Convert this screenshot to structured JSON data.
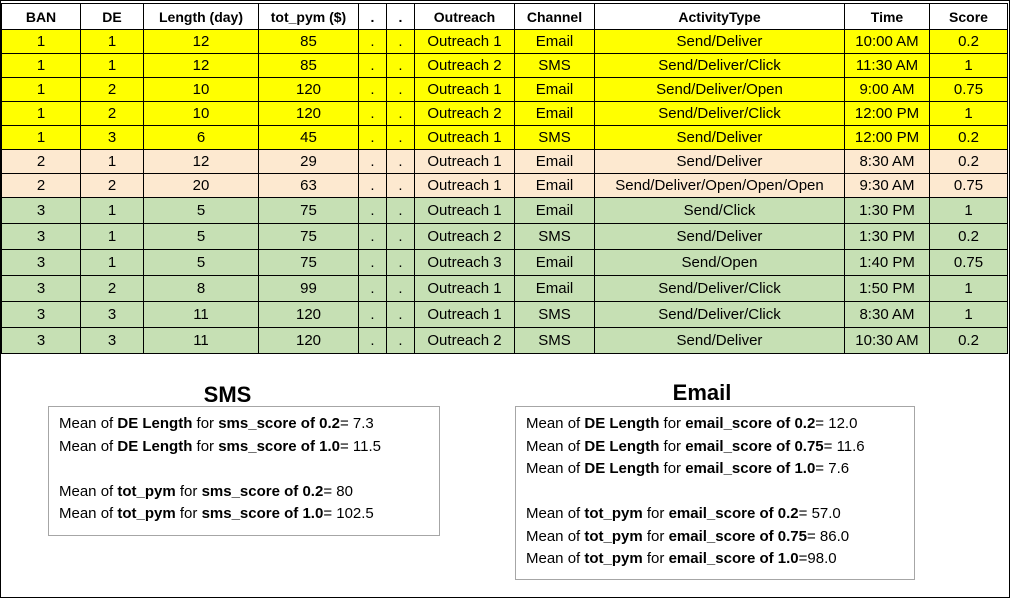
{
  "table": {
    "headers": [
      "BAN",
      "DE",
      "Length (day)",
      "tot_pym ($)",
      ".",
      ".",
      "Outreach",
      "Channel",
      "ActivityType",
      "Time",
      "Score"
    ],
    "rows": [
      {
        "group": "y",
        "cells": [
          "1",
          "1",
          "12",
          "85",
          ".",
          ".",
          "Outreach 1",
          "Email",
          "Send/Deliver",
          "10:00 AM",
          "0.2"
        ]
      },
      {
        "group": "y",
        "cells": [
          "1",
          "1",
          "12",
          "85",
          ".",
          ".",
          "Outreach 2",
          "SMS",
          "Send/Deliver/Click",
          "11:30 AM",
          "1"
        ]
      },
      {
        "group": "y",
        "cells": [
          "1",
          "2",
          "10",
          "120",
          ".",
          ".",
          "Outreach 1",
          "Email",
          "Send/Deliver/Open",
          "9:00 AM",
          "0.75"
        ]
      },
      {
        "group": "y",
        "cells": [
          "1",
          "2",
          "10",
          "120",
          ".",
          ".",
          "Outreach 2",
          "Email",
          "Send/Deliver/Click",
          "12:00 PM",
          "1"
        ]
      },
      {
        "group": "y",
        "cells": [
          "1",
          "3",
          "6",
          "45",
          ".",
          ".",
          "Outreach 1",
          "SMS",
          "Send/Deliver",
          "12:00 PM",
          "0.2"
        ]
      },
      {
        "group": "o",
        "cells": [
          "2",
          "1",
          "12",
          "29",
          ".",
          ".",
          "Outreach 1",
          "Email",
          "Send/Deliver",
          "8:30 AM",
          "0.2"
        ]
      },
      {
        "group": "o",
        "cells": [
          "2",
          "2",
          "20",
          "63",
          ".",
          ".",
          "Outreach 1",
          "Email",
          "Send/Deliver/Open/Open/Open",
          "9:30 AM",
          "0.75"
        ]
      },
      {
        "group": "g",
        "cells": [
          "3",
          "1",
          "5",
          "75",
          ".",
          ".",
          "Outreach 1",
          "Email",
          "Send/Click",
          "1:30 PM",
          "1"
        ]
      },
      {
        "group": "g",
        "cells": [
          "3",
          "1",
          "5",
          "75",
          ".",
          ".",
          "Outreach 2",
          "SMS",
          "Send/Deliver",
          "1:30 PM",
          "0.2"
        ]
      },
      {
        "group": "g",
        "cells": [
          "3",
          "1",
          "5",
          "75",
          ".",
          ".",
          "Outreach 3",
          "Email",
          "Send/Open",
          "1:40 PM",
          "0.75"
        ]
      },
      {
        "group": "g",
        "cells": [
          "3",
          "2",
          "8",
          "99",
          ".",
          ".",
          "Outreach 1",
          "Email",
          "Send/Deliver/Click",
          "1:50 PM",
          "1"
        ]
      },
      {
        "group": "g",
        "cells": [
          "3",
          "3",
          "11",
          "120",
          ".",
          ".",
          "Outreach 1",
          "SMS",
          "Send/Deliver/Click",
          "8:30 AM",
          "1"
        ]
      },
      {
        "group": "g",
        "cells": [
          "3",
          "3",
          "11",
          "120",
          ".",
          ".",
          "Outreach 2",
          "SMS",
          "Send/Deliver",
          "10:30 AM",
          "0.2"
        ]
      }
    ]
  },
  "group_colors": {
    "y": "#ffff00",
    "o": "#fde9d0",
    "g": "#c6e0b4"
  },
  "sms": {
    "heading": "SMS",
    "lines": [
      {
        "pre": "Mean of ",
        "b1": "DE Length",
        "mid": " for ",
        "b2": "sms_score of 0.2",
        "post": "= 7.3"
      },
      {
        "pre": "Mean of ",
        "b1": "DE Length",
        "mid": " for ",
        "b2": "sms_score of 1.0",
        "post": "= 11.5"
      },
      null,
      {
        "pre": "Mean of ",
        "b1": "tot_pym",
        "mid": " for ",
        "b2": "sms_score of 0.2",
        "post": "= 80"
      },
      {
        "pre": "Mean of ",
        "b1": "tot_pym",
        "mid": " for ",
        "b2": "sms_score of 1.0",
        "post": "= 102.5"
      }
    ]
  },
  "email": {
    "heading": "Email",
    "lines": [
      {
        "pre": "Mean of ",
        "b1": "DE Length",
        "mid": " for ",
        "b2": "email_score of 0.2",
        "post": "= 12.0"
      },
      {
        "pre": "Mean of ",
        "b1": "DE Length",
        "mid": " for ",
        "b2": "email_score of 0.75",
        "post": "= 11.6"
      },
      {
        "pre": "Mean of ",
        "b1": "DE Length",
        "mid": " for ",
        "b2": "email_score of 1.0",
        "post": "= 7.6"
      },
      null,
      {
        "pre": "Mean of ",
        "b1": "tot_pym",
        "mid": " for ",
        "b2": "email_score of 0.2",
        "post": "= 57.0"
      },
      {
        "pre": "Mean of ",
        "b1": "tot_pym",
        "mid": " for ",
        "b2": "email_score of 0.75",
        "post": "= 86.0"
      },
      {
        "pre": "Mean of ",
        "b1": "tot_pym",
        "mid": " for ",
        "b2": "email_score of 1.0",
        "post": "=98.0"
      }
    ]
  }
}
